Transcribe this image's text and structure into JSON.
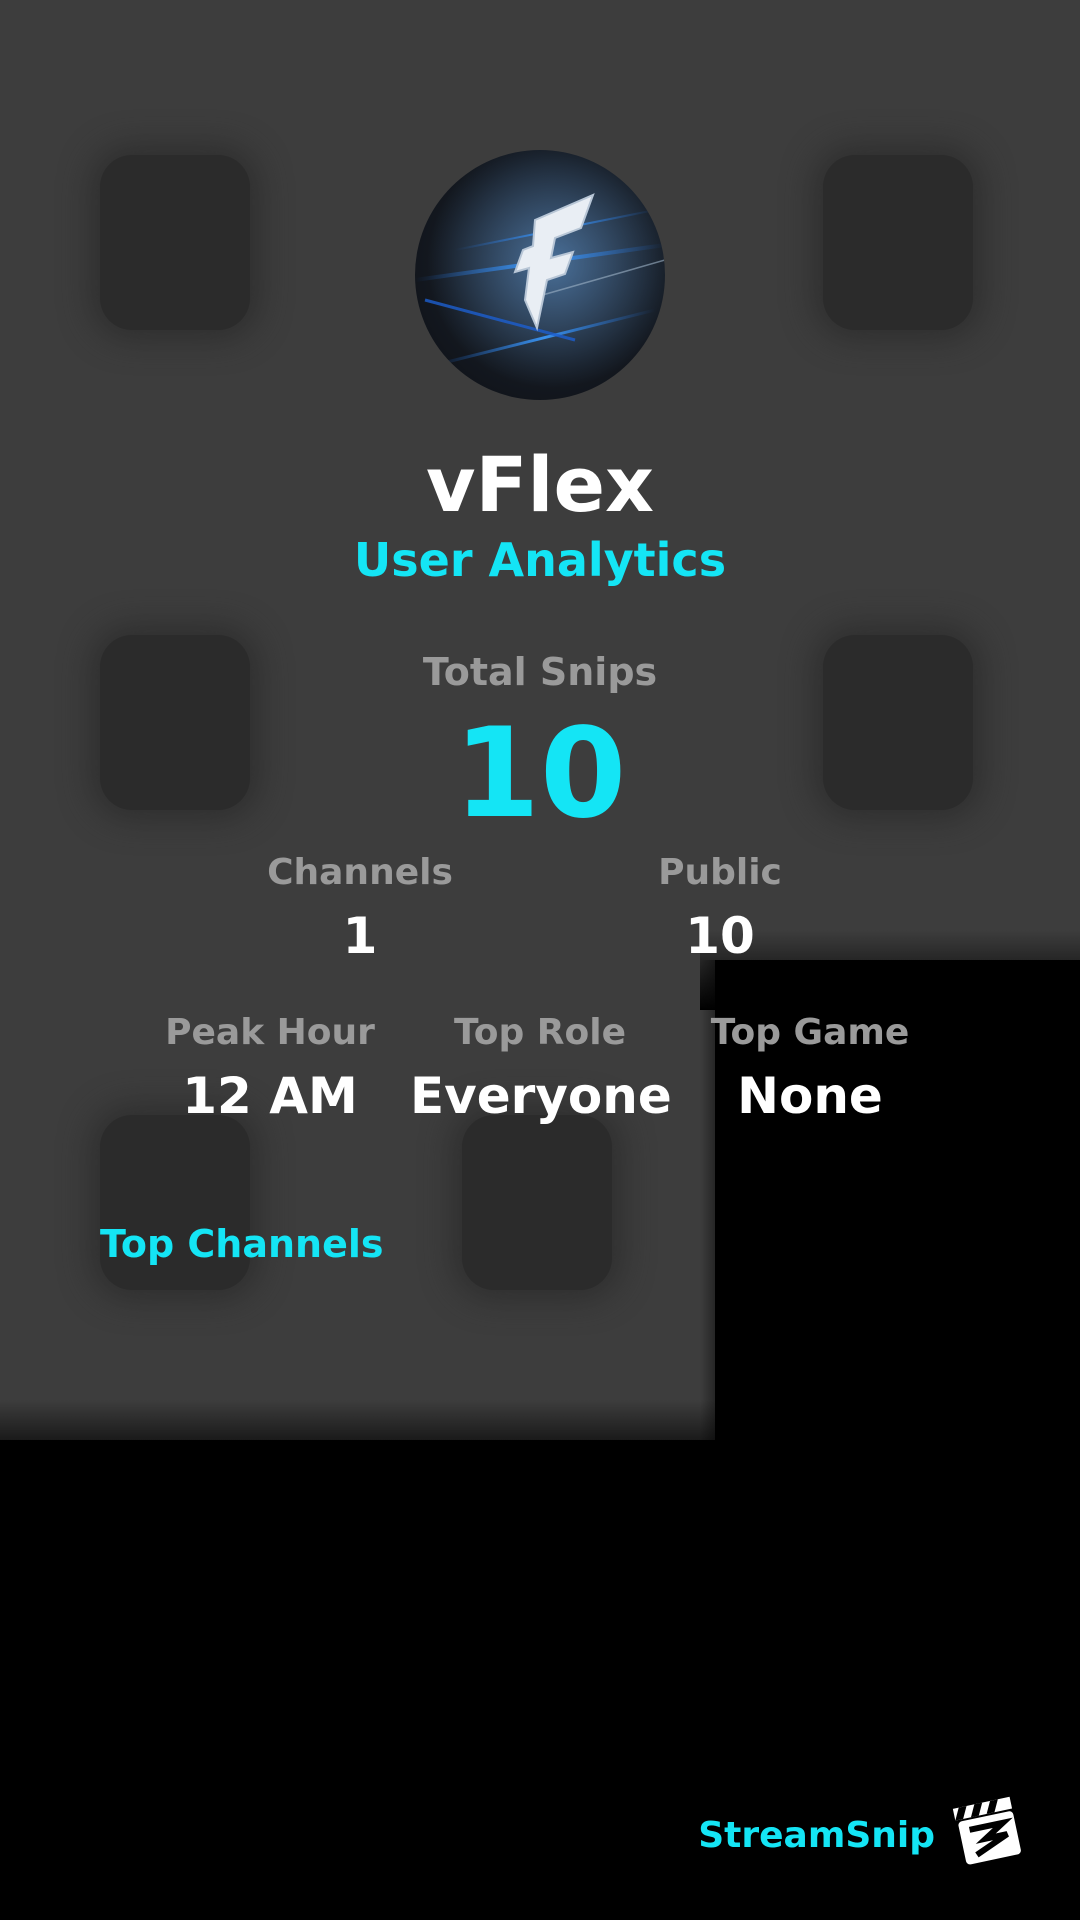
{
  "profile": {
    "username": "vFlex",
    "subtitle": "User Analytics",
    "avatar_icon": "lightning-f-logo-icon"
  },
  "totals": {
    "label": "Total Snips",
    "value": "10"
  },
  "stats": {
    "channels": {
      "label": "Channels",
      "value": "1"
    },
    "public": {
      "label": "Public",
      "value": "10"
    },
    "peak_hour": {
      "label": "Peak Hour",
      "value": "12 AM"
    },
    "top_role": {
      "label": "Top Role",
      "value": "Everyone"
    },
    "top_game": {
      "label": "Top Game",
      "value": "None"
    }
  },
  "sections": {
    "top_channels": "Top Channels"
  },
  "footer": {
    "brand": "StreamSnip",
    "brand_icon": "clapperboard-logo-icon"
  },
  "colors": {
    "accent": "#14e5f5",
    "muted": "#9a9a9a",
    "background": "#000000",
    "panel": "#3d3d3d"
  }
}
